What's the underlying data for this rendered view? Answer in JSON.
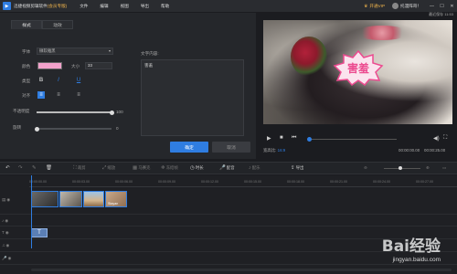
{
  "titlebar": {
    "app_title": "迅捷视频剪辑软件",
    "app_badge": "(会员专版)",
    "menus": [
      "文件",
      "编辑",
      "视图",
      "导出",
      "帮助"
    ],
    "vip_label": "开通VIP",
    "user_name": "托漫阵哥！",
    "save_time": "最近保存 11:53"
  },
  "panel": {
    "tabs": [
      "样式",
      "动效"
    ],
    "font_label": "字体",
    "font_value": "微软雅黑",
    "color_label": "颜色",
    "color_value": "#f2a2cb",
    "size_label": "大小",
    "size_value": "33",
    "type_label": "类型",
    "align_label": "对齐",
    "opacity_label": "不透明度",
    "opacity_value": "100",
    "opacity_level": 1.0,
    "rotate_label": "旋转",
    "rotate_value": "0",
    "rotate_level": 0.0,
    "text_content_label": "文字内容:",
    "text_content": "害羞",
    "ok_label": "确定",
    "cancel_label": "取消"
  },
  "preview": {
    "sticker_text": "害羞",
    "ratio_label": "宽高比:",
    "ratio_value": "16:9",
    "time_current": "00:00:00.00",
    "time_total": "00:00:25.00",
    "progress": 0.0
  },
  "toolbar": {
    "items": [
      "撤销",
      "重做",
      "编辑",
      "删除",
      "裁剪",
      "缩放",
      "马赛克",
      "冻结帧",
      "时长",
      "配音",
      "配乐",
      "添加文字",
      "导出"
    ]
  },
  "timeline": {
    "ticks": [
      "00:00:00.00",
      "00:00:03.00",
      "00:00:06.00",
      "00:00:09.00",
      "00:00:12.00",
      "00:00:15.00",
      "00:00:18.00",
      "00:00:21.00",
      "00:00:24.00",
      "00:00:27.00"
    ],
    "text_clip_label": "T",
    "clip_label": "Stayan"
  },
  "watermark": {
    "logo": "Bai经验",
    "url": "jingyan.baidu.com"
  },
  "colors": {
    "accent": "#2f7de1",
    "vip": "#f0b44c",
    "sticker_text": "#ec4a8f"
  }
}
